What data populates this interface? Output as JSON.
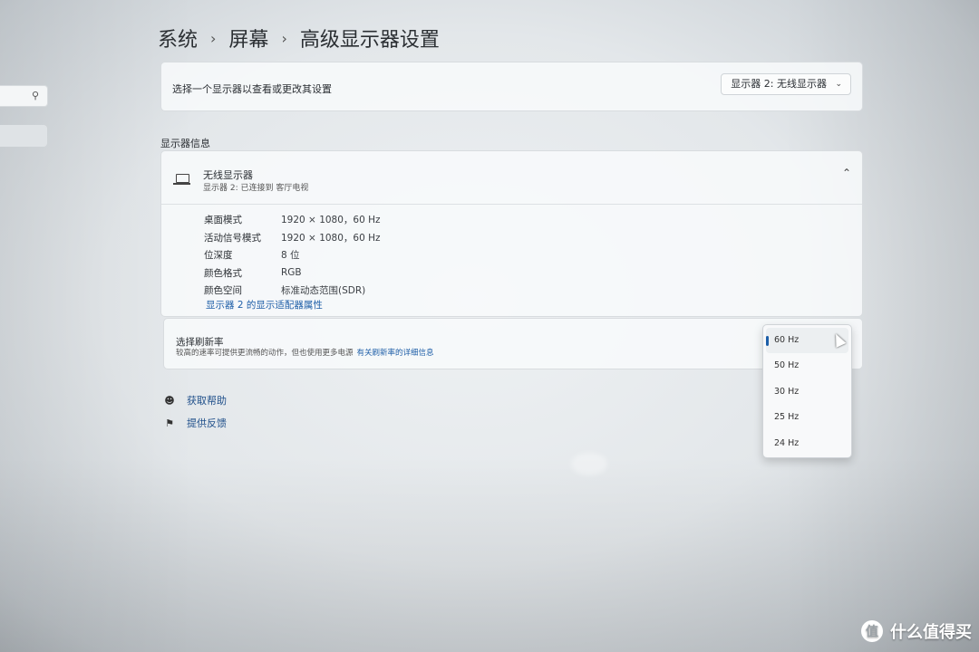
{
  "breadcrumb": {
    "level1": "系统",
    "level2": "屏幕",
    "level3": "高级显示器设置",
    "sep": "›"
  },
  "selector": {
    "label": "选择一个显示器以查看或更改其设置",
    "value": "显示器 2: 无线显示器"
  },
  "section": {
    "title": "显示器信息"
  },
  "display": {
    "name": "无线显示器",
    "subtitle": "显示器 2: 已连接到 客厅电视",
    "rows": [
      {
        "key": "桌面模式",
        "value": "1920 × 1080，60 Hz"
      },
      {
        "key": "活动信号模式",
        "value": "1920 × 1080，60 Hz"
      },
      {
        "key": "位深度",
        "value": "8 位"
      },
      {
        "key": "颜色格式",
        "value": "RGB"
      },
      {
        "key": "颜色空间",
        "value": "标准动态范围(SDR)"
      }
    ],
    "adapter_link": "显示器 2 的显示适配器属性"
  },
  "refresh": {
    "title": "选择刷新率",
    "desc": "较高的速率可提供更流畅的动作，但也使用更多电源",
    "link": "有关刷新率的详细信息",
    "options": [
      "60 Hz",
      "50 Hz",
      "30 Hz",
      "25 Hz",
      "24 Hz"
    ],
    "selected": "60 Hz"
  },
  "help": {
    "get_help": "获取帮助",
    "feedback": "提供反馈"
  },
  "watermark": {
    "logo": "值",
    "text": "什么值得买"
  },
  "icons": {
    "search": "search-icon",
    "laptop": "laptop-icon",
    "collapse": "chevron-up-icon",
    "dropdown": "chevron-down-icon",
    "help": "help-icon",
    "feedback": "feedback-icon"
  }
}
